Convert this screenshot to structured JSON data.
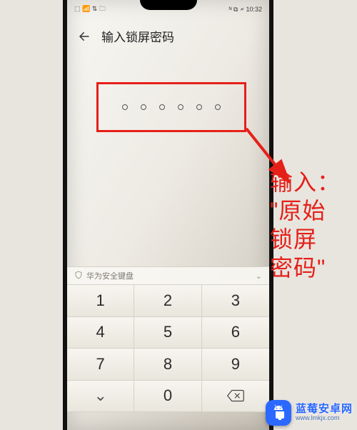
{
  "status": {
    "left": "⬚ 📶 ⇅ 🗀",
    "right": "ᴺ ⧉ 🗲 10:32",
    "time": "10:32"
  },
  "header": {
    "title": "输入锁屏密码"
  },
  "pin": {
    "length": 6
  },
  "keyboardLabel": "华为安全键盘",
  "keypad": {
    "keys": [
      "1",
      "2",
      "3",
      "4",
      "5",
      "6",
      "7",
      "8",
      "9"
    ],
    "zero": "0",
    "collapse": "⌄",
    "backspace": "⌫"
  },
  "annotation": {
    "text": "输入：\n\"原始\n锁屏\n密码\"",
    "lines": [
      "输入：",
      "\"原始",
      "锁屏",
      "密码\""
    ]
  },
  "watermark": {
    "brand": "蓝莓安卓网",
    "url": "www.lmkjx.com"
  }
}
